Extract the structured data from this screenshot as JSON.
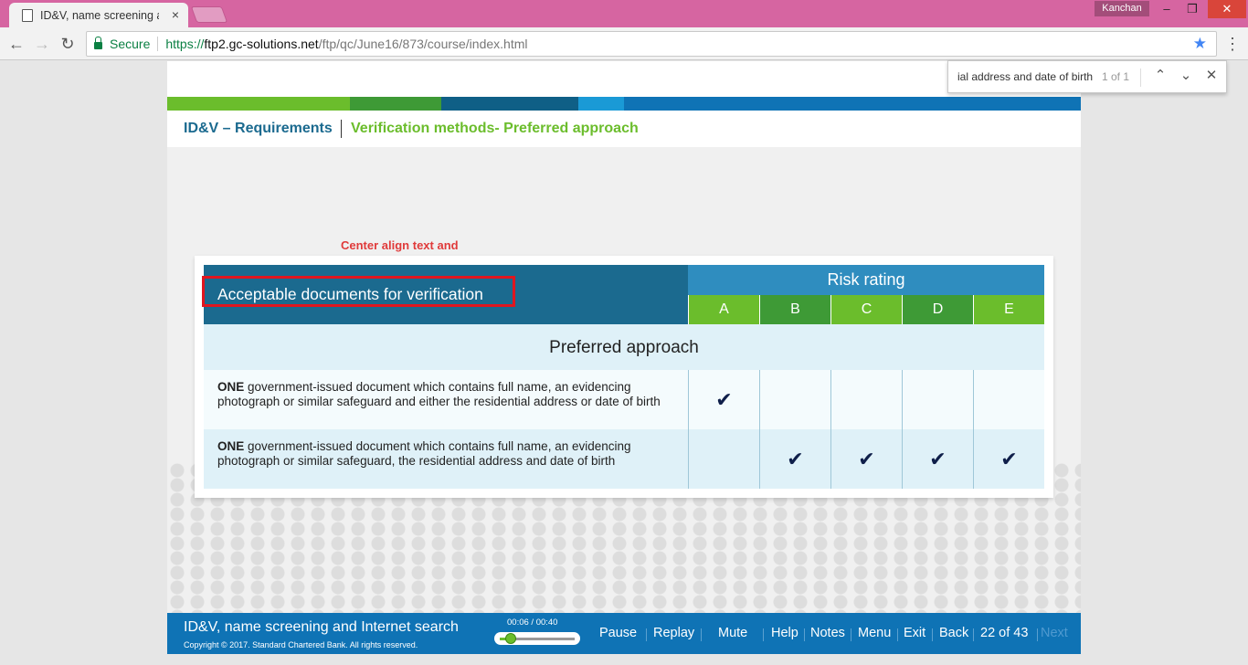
{
  "browser": {
    "tab_title": "ID&V, name screening ar",
    "user": "Kanchan",
    "secure_label": "Secure",
    "url_scheme": "https://",
    "url_domain": "ftp2.gc-solutions.net",
    "url_path": "/ftp/qc/June16/873/course/index.html"
  },
  "find": {
    "query": "ial address and date of birth",
    "count": "1 of 1"
  },
  "breadcrumb": {
    "section": "ID&V – Requirements",
    "topic": "Verification methods- Preferred approach"
  },
  "annotation": "Center align text and done in SB.",
  "table": {
    "header_left": "Acceptable documents for verification",
    "risk_header": "Risk rating",
    "grades": [
      "A",
      "B",
      "C",
      "D",
      "E"
    ],
    "subheader": "Preferred approach",
    "rows": [
      {
        "bold": "ONE",
        "text": " government-issued document which contains full name, an evidencing photograph or similar safeguard and either the residential address or date of birth",
        "checks": [
          true,
          false,
          false,
          false,
          false
        ]
      },
      {
        "bold": "ONE",
        "text": " government-issued document which contains full name, an evidencing photograph or similar safeguard, the residential address and date of birth",
        "checks": [
          false,
          true,
          true,
          true,
          true
        ]
      }
    ]
  },
  "colors": {
    "stripe": [
      "#6bbd2c",
      "#3e9a36",
      "#0f5f86",
      "#1a9ad6",
      "#0f73b5"
    ],
    "grades": [
      "#6bbd2c",
      "#3e9a36",
      "#6bbd2c",
      "#3e9a36",
      "#6bbd2c"
    ]
  },
  "footer": {
    "title": "ID&V, name screening and Internet search",
    "copyright": "Copyright © 2017. Standard Chartered Bank. All rights reserved.",
    "time": "00:06 / 00:40",
    "progress": 0.15,
    "pause": "Pause",
    "replay": "Replay",
    "mute": "Mute",
    "help": "Help",
    "notes": "Notes",
    "menu": "Menu",
    "exit": "Exit",
    "back": "Back",
    "page": "22 of 43",
    "next": "Next"
  }
}
